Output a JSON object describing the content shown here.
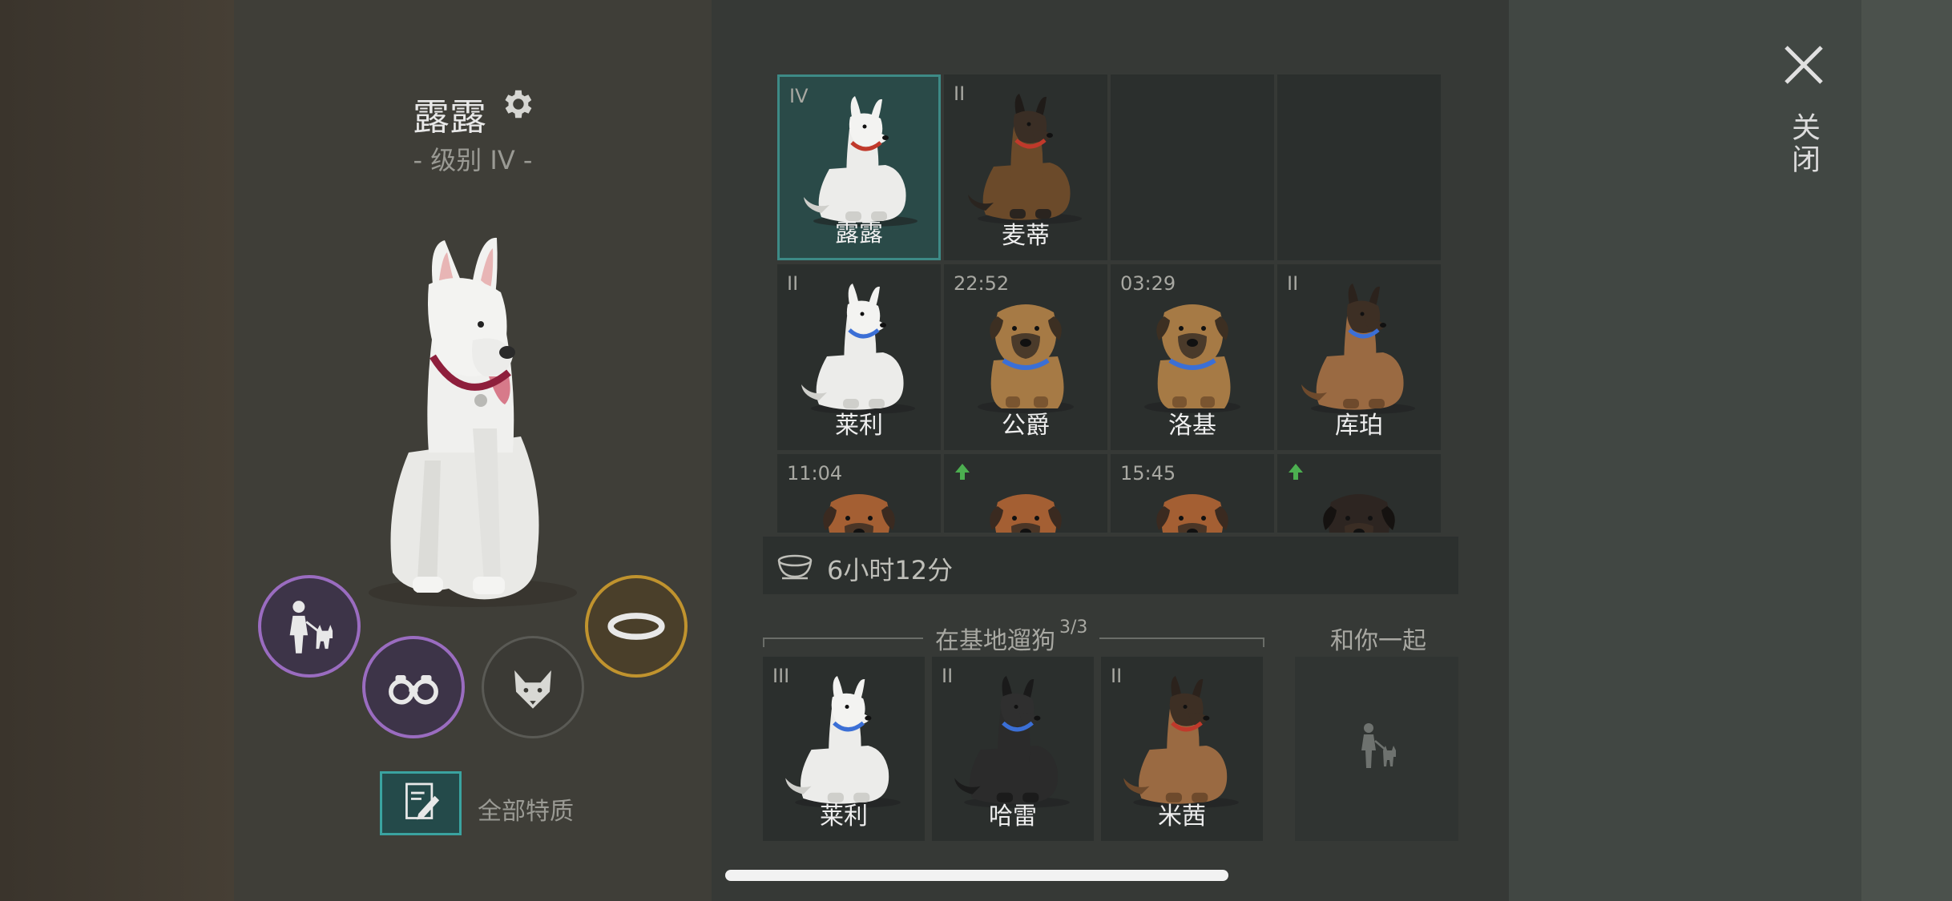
{
  "dog": {
    "name": "露露",
    "level": "- 级别 IV -"
  },
  "traits": {
    "label": "全部特质"
  },
  "grid": {
    "cells": [
      {
        "rank": "IV",
        "name": "露露",
        "color": "white",
        "collar": "#c0392b",
        "selected": true
      },
      {
        "rank": "II",
        "name": "麦蒂",
        "color": "shepherd",
        "collar": "#c0392b"
      },
      {
        "empty": true
      },
      {
        "empty": true
      },
      {
        "rank": "II",
        "name": "莱利",
        "color": "white",
        "collar": "#3b6fd6"
      },
      {
        "rank": "22:52",
        "name": "公爵",
        "color": "puppy",
        "collar": "#3b6fd6"
      },
      {
        "rank": "03:29",
        "name": "洛基",
        "color": "puppy",
        "collar": "#3b6fd6"
      },
      {
        "rank": "II",
        "name": "库珀",
        "color": "tan",
        "collar": "#3b6fd6"
      },
      {
        "rank": "11:04",
        "color": "puppy-red",
        "collar": "#c0392b"
      },
      {
        "upgrade": true,
        "color": "puppy-red",
        "collar": "#c0392b"
      },
      {
        "rank": "15:45",
        "color": "puppy-red",
        "collar": "#c0392b"
      },
      {
        "upgrade": true,
        "color": "puppy-dark",
        "collar": "#c0392b"
      }
    ]
  },
  "food": {
    "text": "6小时12分"
  },
  "walk": {
    "title": "在基地遛狗",
    "count": "3/3",
    "dogs": [
      {
        "rank": "III",
        "name": "莱利",
        "color": "white",
        "collar": "#3b6fd6"
      },
      {
        "rank": "II",
        "name": "哈雷",
        "color": "black",
        "collar": "#3b6fd6"
      },
      {
        "rank": "II",
        "name": "米茜",
        "color": "tan",
        "collar": "#c0392b"
      }
    ]
  },
  "with_you": {
    "label": "和你一起"
  },
  "close": {
    "label": "关闭"
  },
  "colors": {
    "accent_teal": "#3d8a86",
    "walk_purple": "#9a6cc0",
    "collar_gold": "#c0932e",
    "upgrade_green": "#4caf50"
  },
  "icons": [
    "settings-icon",
    "walk-dog-icon",
    "binoculars-icon",
    "fox-icon",
    "collar-icon",
    "edit-traits-icon",
    "food-bowl-icon",
    "upgrade-arrow-icon",
    "close-icon"
  ]
}
